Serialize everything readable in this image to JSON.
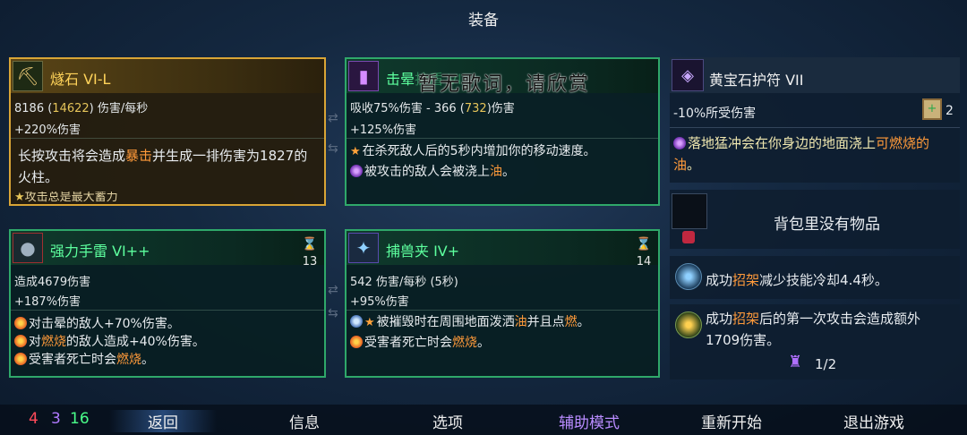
{
  "header": {
    "title": "装备"
  },
  "overlay": {
    "watermark": "暂无歌词，请欣赏"
  },
  "slot_left_top": {
    "icon": "pickaxe-icon",
    "name": "燧石 VI-L",
    "dps_a": "8186 (",
    "dps_b": "14622",
    "dps_c": ") 伤害/每秒",
    "bonus": "+220%伤害",
    "desc_a": "长按攻击将会造成",
    "desc_kw": "暴击",
    "desc_b": "并生成一排伤害为1827的火柱。",
    "clipped": "攻击总是最大蓄力"
  },
  "slot_mid_top": {
    "icon": "purple-lantern-icon",
    "name_prefix": "击晕",
    "name_hidden": "护盾 VI",
    "stat_a": "吸收75%伤害 - 366 (",
    "stat_b": "732",
    "stat_c": ")伤害",
    "bonus": "+125%伤害",
    "line1": "在杀死敌人后的5秒内增加你的移动速度。",
    "line2_a": "被攻击的敌人会被浇上",
    "line2_kw": "油",
    "line2_b": "。"
  },
  "slot_left_bottom": {
    "icon": "bomb-icon",
    "name": "强力手雷 VI++",
    "timer": "13",
    "stat": "造成4679伤害",
    "bonus": "+187%伤害",
    "line1": "对击晕的敌人+70%伤害。",
    "line2_a": "对",
    "line2_kw": "燃烧",
    "line2_b": "的敌人造成+40%伤害。",
    "line3_a": "受害者死亡时会",
    "line3_kw": "燃烧",
    "line3_b": "。"
  },
  "slot_mid_bottom": {
    "icon": "trap-icon",
    "name": "捕兽夹 IV+",
    "timer": "14",
    "stat": "542 伤害/每秒 (5秒)",
    "bonus": "+95%伤害",
    "line1_a": "被摧毁时在周围地面泼洒",
    "line1_kw": "油",
    "line1_b": "并且点",
    "line1_c": "燃",
    "line1_d": "。",
    "line2_a": "受害者死亡时会",
    "line2_kw": "燃烧",
    "line2_b": "。"
  },
  "amulet": {
    "icon": "amulet-icon",
    "name": "黄宝石护符 VII",
    "stat": "-10%所受伤害",
    "scroll_icon": "scroll-icon",
    "scroll_count": "2",
    "effect_a": "落地猛冲会在你身边的地面浇上",
    "effect_kw": "可燃烧的油",
    "effect_b": "。"
  },
  "backpack": {
    "empty_text": "背包里没有物品",
    "badge_icon": "cursed-badge-icon"
  },
  "mutations": [
    {
      "icon": "shield-mutation-icon",
      "text_a": "成功",
      "kw": "招架",
      "text_b": "减少技能冷却4.4秒。"
    },
    {
      "icon": "parry-mutation-icon",
      "text_a": "成功",
      "kw": "招架",
      "text_b": "后的第一次攻击会造成额外1709伤害。"
    }
  ],
  "mutation_counter": {
    "icon": "cloak-icon",
    "value": "1/2"
  },
  "scrolls": {
    "red": "4",
    "purple": "3",
    "green": "16"
  },
  "menu": {
    "back": "返回",
    "info": "信息",
    "options": "选项",
    "assist": "辅助模式",
    "restart": "重新开始",
    "quit": "退出游戏"
  },
  "colors": {
    "gold_border": "#d9a536",
    "green_border": "#2fa86a",
    "keyword_orange": "#ff9a3a",
    "assist_purple": "#b98cff"
  }
}
